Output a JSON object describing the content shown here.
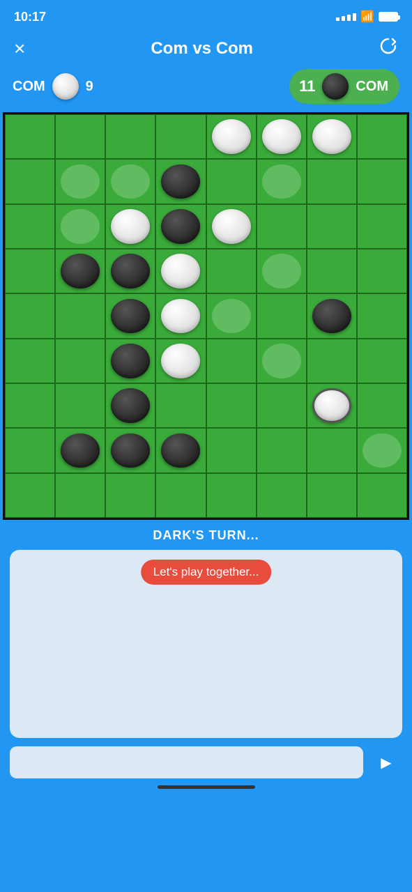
{
  "statusBar": {
    "time": "10:17",
    "battery": "full",
    "wifi": "on"
  },
  "header": {
    "title": "Com vs Com",
    "closeLabel": "×",
    "resetLabel": "↺"
  },
  "scoreLeft": {
    "playerLabel": "COM",
    "score": "9"
  },
  "scoreRight": {
    "playerLabel": "COM",
    "score": "11"
  },
  "board": {
    "grid": [
      [
        "",
        "",
        "",
        "",
        "W",
        "W",
        "W",
        ""
      ],
      [
        "",
        "G",
        "G",
        "B",
        "",
        "G",
        "",
        ""
      ],
      [
        "",
        "G",
        "W",
        "B",
        "W",
        "",
        "",
        ""
      ],
      [
        "",
        "B",
        "B",
        "W",
        "",
        "G",
        "",
        ""
      ],
      [
        "",
        "",
        "B",
        "W",
        "G",
        "",
        "B",
        ""
      ],
      [
        "",
        "",
        "B",
        "W",
        "",
        "G",
        "",
        ""
      ],
      [
        "",
        "",
        "B",
        "",
        "",
        "",
        "WR",
        ""
      ],
      [
        "",
        "B",
        "B",
        "B",
        "",
        "",
        "",
        "G"
      ],
      [
        "",
        "",
        "",
        "",
        "",
        "",
        "",
        ""
      ]
    ]
  },
  "statusText": "DARK'S TURN...",
  "chat": {
    "bubble": "Let's play together...",
    "inputPlaceholder": ""
  },
  "sendButton": "➤"
}
